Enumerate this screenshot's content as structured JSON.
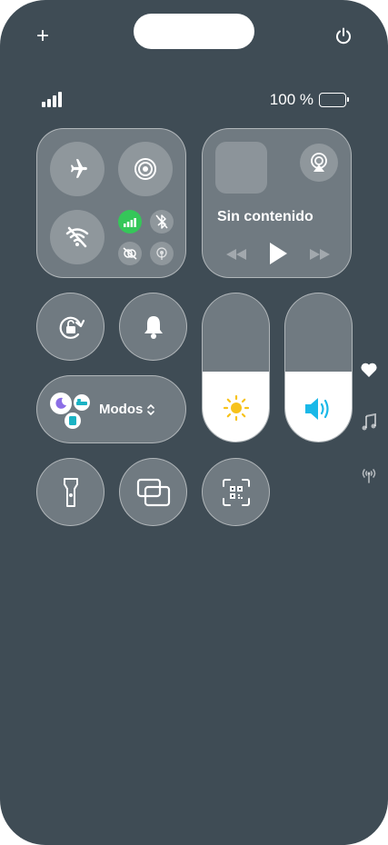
{
  "status_bar": {
    "battery_text": "100 %",
    "battery_level": 100
  },
  "top_bar": {
    "add_icon": "plus-icon",
    "power_icon": "power-icon"
  },
  "connectivity": {
    "airplane_icon": "airplane-icon",
    "airdrop_icon": "airdrop-icon",
    "wifi_icon": "wifi-off-icon",
    "cellular_icon": "cellular-icon",
    "bluetooth_icon": "bluetooth-off-icon",
    "link_icon": "link-off-icon",
    "hotspot_icon": "hotspot-icon"
  },
  "media": {
    "title": "Sin contenido",
    "airplay_icon": "airplay-icon",
    "rewind_icon": "rewind-icon",
    "play_icon": "play-icon",
    "forward_icon": "forward-icon"
  },
  "controls": {
    "rotation_lock_icon": "rotation-lock-icon",
    "bell_icon": "bell-icon",
    "modes_label": "Modos",
    "flashlight_icon": "flashlight-icon",
    "screen_mirroring_icon": "screen-mirroring-icon",
    "qr_scanner_icon": "qr-code-icon"
  },
  "sliders": {
    "brightness_level": 0.47,
    "volume_level": 0.47
  },
  "side_pages": {
    "favorites_icon": "heart-icon",
    "music_icon": "music-note-icon",
    "connectivity_icon": "antenna-icon"
  },
  "colors": {
    "background": "#3f4c55",
    "active_green": "#35c759",
    "sun_yellow": "#f7c21b",
    "volume_blue": "#1ab8e8"
  }
}
